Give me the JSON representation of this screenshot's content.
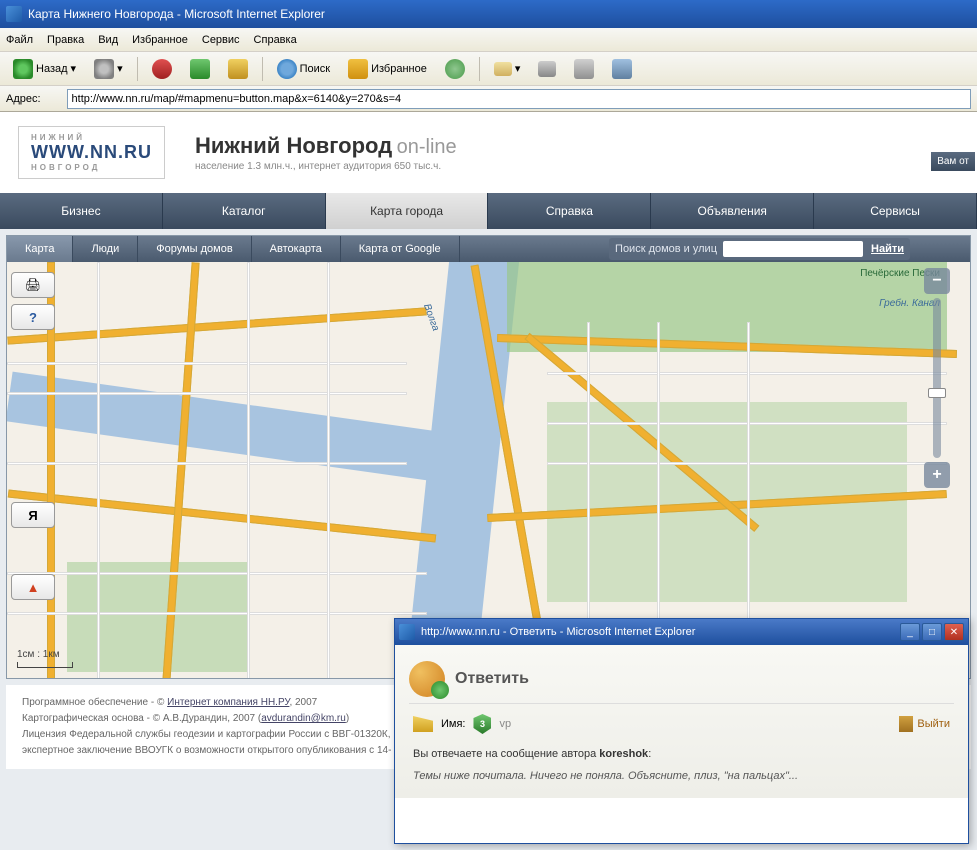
{
  "window": {
    "title": "Карта Нижнего Новгорода - Microsoft Internet Explorer"
  },
  "menu": {
    "file": "Файл",
    "edit": "Правка",
    "view": "Вид",
    "fav": "Избранное",
    "tools": "Сервис",
    "help": "Справка"
  },
  "toolbar": {
    "back": "Назад",
    "search": "Поиск",
    "favorites": "Избранное"
  },
  "address": {
    "label": "Адрес:",
    "url": "http://www.nn.ru/map/#mapmenu=button.map&x=6140&y=270&s=4"
  },
  "logo": {
    "top": "НИЖНИЙ",
    "mid": "WWW.NN.RU",
    "bot": "НОВГОРОД"
  },
  "header": {
    "title": "Нижний Новгород",
    "online": "on-line",
    "sub": "население 1.3 млн.ч., интернет аудитория 650 тыс.ч."
  },
  "corner": {
    "label": "Вам от"
  },
  "nav": {
    "biz": "Бизнес",
    "cat": "Каталог",
    "map": "Карта города",
    "help": "Справка",
    "ads": "Объявления",
    "serv": "Сервисы"
  },
  "maptabs": {
    "map": "Карта",
    "people": "Люди",
    "forums": "Форумы домов",
    "auto": "Автокарта",
    "google": "Карта от Google"
  },
  "search": {
    "label": "Поиск домов и улиц",
    "btn": "Найти"
  },
  "sidebtns": {
    "ya": "Я"
  },
  "map_labels": {
    "river": "Волга",
    "park": "Печёрские Пески",
    "canal": "Гребн. Канал"
  },
  "scale": {
    "text": "1см : 1км"
  },
  "footer": {
    "l1a": "Программное обеспечение - © ",
    "l1b": "Интернет компания НН.РУ",
    "l1c": ", 2007",
    "l2a": "Картографическая основа - © А.В.Дурандин, 2007 (",
    "l2b": "avdurandin@km.ru",
    "l2c": ")",
    "l3": "Лицензия Федеральной службы геодезии и картографии России с ВВГ-01320К,",
    "l4": "экспертное заключение ВВОУГК о возможности открытого опубликования с 14-"
  },
  "popup": {
    "title": "http://www.nn.ru - Ответить - Microsoft Internet Explorer",
    "heading": "Ответить",
    "name_label": "Имя:",
    "badge": "3",
    "username": "vp",
    "exit": "Выйти",
    "reply_prefix": "Вы отвечаете на сообщение автора ",
    "reply_author": "koreshok",
    "reply_suffix": ":",
    "quote": "Темы ниже почитала. Ничего не поняла. Объясните, плиз, \"на пальцах\"..."
  }
}
